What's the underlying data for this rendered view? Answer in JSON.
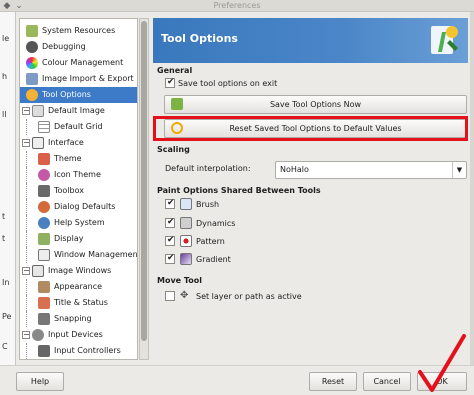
{
  "window": {
    "title": "Preferences"
  },
  "left_strip": [
    "le",
    "h",
    "ll",
    "t",
    "t",
    "In",
    "Pe",
    "C"
  ],
  "sidebar": {
    "items": [
      {
        "label": "System Resources",
        "level": 1,
        "icon": "system-resources-icon",
        "color": "#6b8e23"
      },
      {
        "label": "Debugging",
        "level": 1,
        "icon": "debugging-icon",
        "color": "#444"
      },
      {
        "label": "Colour Management",
        "level": 1,
        "icon": "colour-management-icon",
        "color": "#d94a8c"
      },
      {
        "label": "Image Import & Export",
        "level": 1,
        "icon": "image-import-export-icon",
        "color": "#5a7fb5"
      },
      {
        "label": "Tool Options",
        "level": 1,
        "icon": "tool-options-icon",
        "color": "#2e6bc0",
        "selected": true
      },
      {
        "label": "Default Image",
        "level": 1,
        "icon": "default-image-icon",
        "color": "#888",
        "expander": "−"
      },
      {
        "label": "Default Grid",
        "level": 2,
        "icon": "default-grid-icon",
        "color": "#999"
      },
      {
        "label": "Interface",
        "level": 1,
        "icon": "interface-icon",
        "color": "#777",
        "expander": "−"
      },
      {
        "label": "Theme",
        "level": 2,
        "icon": "theme-icon",
        "color": "#c64a3a"
      },
      {
        "label": "Icon Theme",
        "level": 2,
        "icon": "icon-theme-icon",
        "color": "#b04090"
      },
      {
        "label": "Toolbox",
        "level": 2,
        "icon": "toolbox-icon",
        "color": "#555"
      },
      {
        "label": "Dialog Defaults",
        "level": 2,
        "icon": "dialog-defaults-icon",
        "color": "#c05030"
      },
      {
        "label": "Help System",
        "level": 2,
        "icon": "help-system-icon",
        "color": "#3b6fb0"
      },
      {
        "label": "Display",
        "level": 2,
        "icon": "display-icon",
        "color": "#7a9a4a"
      },
      {
        "label": "Window Management",
        "level": 2,
        "icon": "window-management-icon",
        "color": "#888"
      },
      {
        "label": "Image Windows",
        "level": 1,
        "icon": "image-windows-icon",
        "color": "#777",
        "expander": "−"
      },
      {
        "label": "Appearance",
        "level": 2,
        "icon": "appearance-icon",
        "color": "#8a6a4a"
      },
      {
        "label": "Title & Status",
        "level": 2,
        "icon": "title-status-icon",
        "color": "#c06040"
      },
      {
        "label": "Snapping",
        "level": 2,
        "icon": "snapping-icon",
        "color": "#666"
      },
      {
        "label": "Input Devices",
        "level": 1,
        "icon": "input-devices-icon",
        "color": "#777",
        "expander": "−"
      },
      {
        "label": "Input Controllers",
        "level": 2,
        "icon": "input-controllers-icon",
        "color": "#666"
      }
    ]
  },
  "header": {
    "title": "Tool Options",
    "icon": "tool-options-header-icon"
  },
  "general": {
    "heading": "General",
    "save_on_exit": {
      "label": "Save tool options on exit",
      "checked": true
    },
    "save_now_label": "Save Tool Options Now",
    "reset_label": "Reset Saved Tool Options to Default Values"
  },
  "scaling": {
    "heading": "Scaling",
    "interpolation_label": "Default interpolation:",
    "interpolation_value": "NoHalo"
  },
  "paint_options": {
    "heading": "Paint Options Shared Between Tools",
    "items": [
      {
        "label": "Brush",
        "checked": true,
        "icon": "brush-icon"
      },
      {
        "label": "Dynamics",
        "checked": true,
        "icon": "dynamics-icon"
      },
      {
        "label": "Pattern",
        "checked": true,
        "icon": "pattern-icon"
      },
      {
        "label": "Gradient",
        "checked": true,
        "icon": "gradient-icon"
      }
    ]
  },
  "move_tool": {
    "heading": "Move Tool",
    "set_layer": {
      "label": "Set layer or path as active",
      "checked": false
    }
  },
  "buttons": {
    "help": "Help",
    "reset": "Reset",
    "cancel": "Cancel",
    "ok": "OK"
  },
  "colors": {
    "accent": "#3d7ac7",
    "highlight": "#e4101a"
  }
}
